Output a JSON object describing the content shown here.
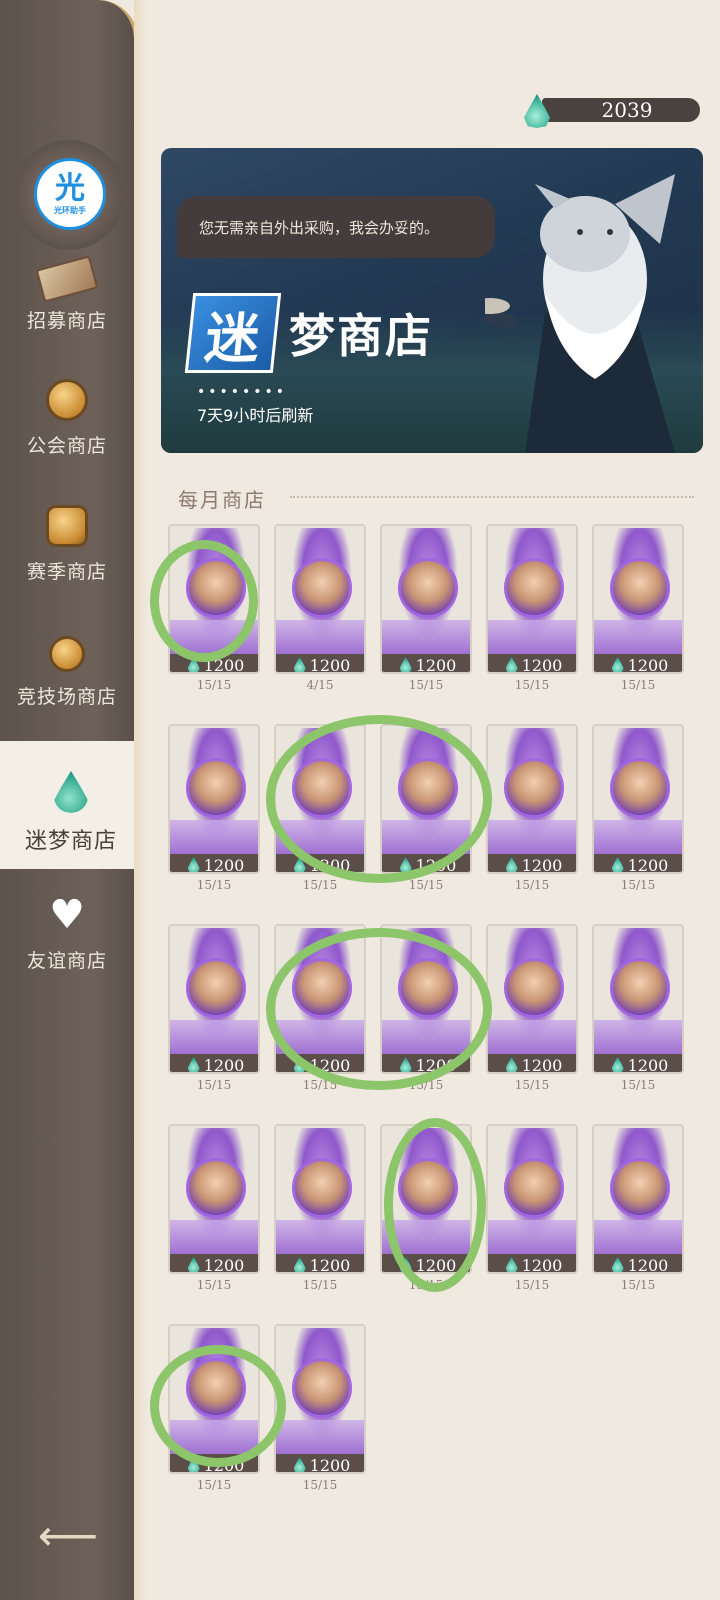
{
  "sidebar": {
    "logo_big": "光",
    "logo_small": "光环助手",
    "items": [
      {
        "label": "招募商店",
        "icon": "ticket-icon"
      },
      {
        "label": "公会商店",
        "icon": "guild-coin-icon"
      },
      {
        "label": "赛季商店",
        "icon": "season-coin-icon"
      },
      {
        "label": "竞技场商店",
        "icon": "arena-coin-icon"
      },
      {
        "label": "迷梦商店",
        "icon": "dream-drop-icon"
      },
      {
        "label": "友谊商店",
        "icon": "heart-icon"
      }
    ],
    "back": "back-arrow-icon"
  },
  "currency": {
    "amount": "2039"
  },
  "banner": {
    "speech": "您无需亲自外出采购，我会办妥的。",
    "brand_mark": "迷",
    "brand_text": "梦商店",
    "dots": "••••••••",
    "refresh": "7天9小时后刷新"
  },
  "section": {
    "title": "每月商店"
  },
  "cards": [
    {
      "price": "1200",
      "stock": "15/15"
    },
    {
      "price": "1200",
      "stock": "4/15"
    },
    {
      "price": "1200",
      "stock": "15/15"
    },
    {
      "price": "1200",
      "stock": "15/15"
    },
    {
      "price": "1200",
      "stock": "15/15"
    },
    {
      "price": "1200",
      "stock": "15/15"
    },
    {
      "price": "1200",
      "stock": "15/15"
    },
    {
      "price": "1200",
      "stock": "15/15"
    },
    {
      "price": "1200",
      "stock": "15/15"
    },
    {
      "price": "1200",
      "stock": "15/15"
    },
    {
      "price": "1200",
      "stock": "15/15"
    },
    {
      "price": "1200",
      "stock": "15/15"
    },
    {
      "price": "1200",
      "stock": "15/15"
    },
    {
      "price": "1200",
      "stock": "15/15"
    },
    {
      "price": "1200",
      "stock": "15/15"
    },
    {
      "price": "1200",
      "stock": "15/15"
    },
    {
      "price": "1200",
      "stock": "15/15"
    },
    {
      "price": "1200",
      "stock": "15/15"
    },
    {
      "price": "1200",
      "stock": "15/15"
    },
    {
      "price": "1200",
      "stock": "15/15"
    },
    {
      "price": "1200",
      "stock": "15/15"
    },
    {
      "price": "1200",
      "stock": "15/15"
    }
  ],
  "colors": {
    "accent_green_marker": "#8cc56a",
    "sidebar": "#6d615a",
    "gem": "#2aa58e"
  }
}
